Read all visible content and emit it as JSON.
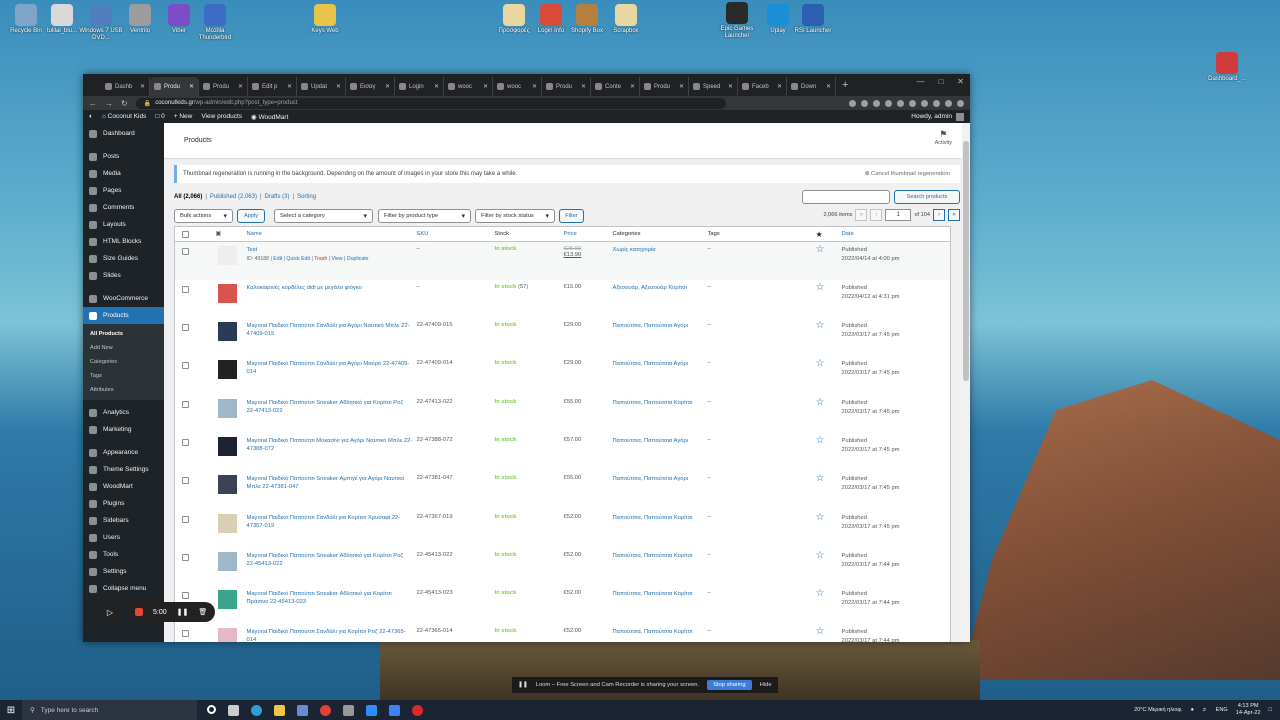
{
  "desktop": {
    "icons": [
      {
        "label": "Recycle Bin",
        "color": "#7fa4c7"
      },
      {
        "label": "tulilai_blu...",
        "color": "#d9d9d9"
      },
      {
        "label": "Windows 7 USB DVD...",
        "color": "#4f7fbf"
      },
      {
        "label": "Ventrilo",
        "color": "#9c9c9c"
      },
      {
        "label": "Viber",
        "color": "#7d4cc7"
      },
      {
        "label": "Mozilla Thunderbird",
        "color": "#3d6cc4"
      },
      {
        "label": "Keys Web",
        "color": "#e8c44c"
      },
      {
        "label": "Προσφορές",
        "color": "#e8d7a0"
      },
      {
        "label": "Login Info",
        "color": "#d84a3a"
      },
      {
        "label": "Shopify Box",
        "color": "#b5803d"
      },
      {
        "label": "Scrapbox",
        "color": "#e8d7a0"
      },
      {
        "label": "Epic Games Launcher",
        "color": "#2a2a2a"
      },
      {
        "label": "Uplay",
        "color": "#1a8fd6"
      },
      {
        "label": "RSI Launcher",
        "color": "#2c5fb0"
      },
      {
        "label": "Dashboard_...",
        "color": "#d23b3b"
      }
    ]
  },
  "browser": {
    "tabs": [
      "Dashb",
      "Produ",
      "Produ",
      "Edit p",
      "Updat",
      "Εισαγ",
      "Login",
      "wooc",
      "wooc",
      "Produ",
      "Conte",
      "Produ",
      "Speed",
      "Faceb",
      "Down"
    ],
    "active_tab_index": 1,
    "url_host": "coconutkids.gr",
    "url_path": "/wp-admin/edit.php?post_type=product"
  },
  "adminbar": {
    "site": "Coconut Kids",
    "comments": "0",
    "new": "New",
    "view": "View products",
    "theme": "WoodMart",
    "howdy": "Howdy, admin"
  },
  "menu": {
    "items": [
      {
        "label": "Dashboard",
        "group": 0
      },
      {
        "label": "Posts",
        "group": 1
      },
      {
        "label": "Media",
        "group": 1
      },
      {
        "label": "Pages",
        "group": 1
      },
      {
        "label": "Comments",
        "group": 1
      },
      {
        "label": "Layouts",
        "group": 1
      },
      {
        "label": "HTML Blocks",
        "group": 1
      },
      {
        "label": "Size Guides",
        "group": 1
      },
      {
        "label": "Slides",
        "group": 1
      },
      {
        "label": "WooCommerce",
        "group": 2
      },
      {
        "label": "Products",
        "group": 2,
        "current": true
      }
    ],
    "submenu": [
      "All Products",
      "Add New",
      "Categories",
      "Tags",
      "Attributes"
    ],
    "items_after": [
      {
        "label": "Analytics",
        "group": 3
      },
      {
        "label": "Marketing",
        "group": 3
      },
      {
        "label": "Appearance",
        "group": 4
      },
      {
        "label": "Theme Settings",
        "group": 4
      },
      {
        "label": "WoodMart",
        "group": 4
      },
      {
        "label": "Plugins",
        "group": 4
      },
      {
        "label": "Sidebars",
        "group": 4
      },
      {
        "label": "Users",
        "group": 4
      },
      {
        "label": "Tools",
        "group": 4
      },
      {
        "label": "Settings",
        "group": 4
      },
      {
        "label": "Collapse menu",
        "group": 4
      }
    ]
  },
  "page": {
    "header_title": "Products",
    "activity": "Activity",
    "notice": "Thumbnail regeneration is running in the background. Depending on the amount of images in your store this may take a while.",
    "notice_cancel": "Cancel thumbnail regeneration",
    "views": {
      "all": "All (2,066)",
      "published": "Published (2,063)",
      "drafts": "Drafts (3)",
      "sorting": "Sorting"
    },
    "search_button": "Search products",
    "bulk_actions": "Bulk actions",
    "apply": "Apply",
    "category_select": "Select a category",
    "type_select": "Filter by product type",
    "stock_select": "Filter by stock status",
    "filter": "Filter",
    "items_count": "2,066 items",
    "current_page": "1",
    "total_pages": "of 104",
    "columns": {
      "name": "Name",
      "sku": "SKU",
      "stock": "Stock",
      "price": "Price",
      "categories": "Categories",
      "tags": "Tags",
      "date": "Date"
    }
  },
  "products": [
    {
      "name": "Test",
      "row_actions": {
        "id": "ID: 49188",
        "edit": "Edit",
        "quick": "Quick Edit",
        "trash": "Trash",
        "view": "View",
        "dup": "Duplicate"
      },
      "sku": "–",
      "stock": "In stock",
      "qty": "",
      "price_old": "€25.00",
      "price": "€13.90",
      "cats": "Χωρίς κατηγορία",
      "tags": "–",
      "status": "Published",
      "date": "2022/04/14 at 4:00 pm",
      "thumb": "#eeeeee"
    },
    {
      "name": "Καλοκαιρινές κορδέλες didi με μεγάλο φιόγκο",
      "sku": "–",
      "stock": "In stock",
      "qty": "(57)",
      "price_old": "",
      "price": "€15.00",
      "cats": "Αξεσουάρ, Αξεσουάρ Κορίτσι",
      "tags": "–",
      "status": "Published",
      "date": "2022/04/12 at 4:31 pm",
      "thumb": "#d9534f"
    },
    {
      "name": "Mayoral Παιδικό Παπούτσι Σανδάλι για Αγόρι Ναυτικό Μπλε 22-47409-015",
      "sku": "22-47409-015",
      "stock": "In stock",
      "qty": "",
      "price_old": "",
      "price": "€29.00",
      "cats": "Παπούτσια, Παπούτσια Αγόρι",
      "tags": "–",
      "status": "Published",
      "date": "2022/03/17 at 7:45 pm",
      "thumb": "#2b3a55"
    },
    {
      "name": "Mayoral Παιδικό Παπούτσι Σανδάλι για Αγόρι Μαύρο 22-47409-014",
      "sku": "22-47409-014",
      "stock": "In stock",
      "qty": "",
      "price_old": "",
      "price": "€29.00",
      "cats": "Παπούτσια, Παπούτσια Αγόρι",
      "tags": "–",
      "status": "Published",
      "date": "2022/03/17 at 7:45 pm",
      "thumb": "#222222"
    },
    {
      "name": "Mayoral Παιδικό Παπούτσι Sneaker Αθλητικό για Κορίτσι Ροζ 22-47413-022",
      "sku": "22-47413-022",
      "stock": "In stock",
      "qty": "",
      "price_old": "",
      "price": "€55.00",
      "cats": "Παπούτσια, Παπούτσια Κορίτσι",
      "tags": "–",
      "status": "Published",
      "date": "2022/03/17 at 7:45 pm",
      "thumb": "#9fb7c9"
    },
    {
      "name": "Mayoral Παιδικό Παπούτσι Μοκασίνι για Αγόρι Ναυτικό Μπλε 22-47388-072",
      "sku": "22-47388-072",
      "stock": "In stock",
      "qty": "",
      "price_old": "",
      "price": "€57.00",
      "cats": "Παπούτσια, Παπούτσια Αγόρι",
      "tags": "–",
      "status": "Published",
      "date": "2022/03/17 at 7:45 pm",
      "thumb": "#1d2333"
    },
    {
      "name": "Mayoral Παιδικό Παπούτσι Sneaker Αμπιγέ για Αγόρι Ναυτικό Μπλε 22-47381-047",
      "sku": "22-47381-047",
      "stock": "In stock",
      "qty": "",
      "price_old": "",
      "price": "€55.00",
      "cats": "Παπούτσια, Παπούτσια Αγόρι",
      "tags": "–",
      "status": "Published",
      "date": "2022/03/17 at 7:45 pm",
      "thumb": "#3a4356"
    },
    {
      "name": "Mayoral Παιδικό Παπούτσι Σανδάλι για Κορίτσι Χρυσαφί 22-47367-019",
      "sku": "22-47367-019",
      "stock": "In stock",
      "qty": "",
      "price_old": "",
      "price": "€52.00",
      "cats": "Παπούτσια, Παπούτσια Κορίτσι",
      "tags": "–",
      "status": "Published",
      "date": "2022/03/17 at 7:45 pm",
      "thumb": "#d8cfb5"
    },
    {
      "name": "Mayoral Παιδικό Παπούτσι Sneaker Αθλητικό για Κορίτσι Ροζ 22-45413-022",
      "sku": "22-45413-022",
      "stock": "In stock",
      "qty": "",
      "price_old": "",
      "price": "€52.00",
      "cats": "Παπούτσια, Παπούτσια Κορίτσι",
      "tags": "–",
      "status": "Published",
      "date": "2022/03/17 at 7:44 pm",
      "thumb": "#9fb7c9"
    },
    {
      "name": "Mayoral Παιδικό Παπούτσι Sneaker Αθλητικό για Κορίτσι Πράσινο 22-45413-023",
      "sku": "22-45413-023",
      "stock": "In stock",
      "qty": "",
      "price_old": "",
      "price": "€52.00",
      "cats": "Παπούτσια, Παπούτσια Κορίτσι",
      "tags": "–",
      "status": "Published",
      "date": "2022/03/17 at 7:44 pm",
      "thumb": "#3aa58c"
    },
    {
      "name": "Mayoral Παιδικό Παπούτσι Σανδάλι για Κορίτσι Ροζ 22-47365-014",
      "sku": "22-47365-014",
      "stock": "In stock",
      "qty": "",
      "price_old": "",
      "price": "€52.00",
      "cats": "Παπούτσια, Παπούτσια Κορίτσι",
      "tags": "–",
      "status": "Published",
      "date": "2022/03/17 at 7:44 pm",
      "thumb": "#e6b7c4"
    }
  ],
  "recorder": {
    "time": "5:00"
  },
  "loom": {
    "message": "Loom – Free Screen and Cam Recorder is sharing your screen.",
    "stop": "Stop sharing",
    "hide": "Hide"
  },
  "taskbar": {
    "search_placeholder": "Type here to search",
    "weather": "20°C  Μερική ηλιοφ.",
    "lang": "ENG",
    "time": "4:13 PM",
    "date": "14-Apr-22"
  }
}
